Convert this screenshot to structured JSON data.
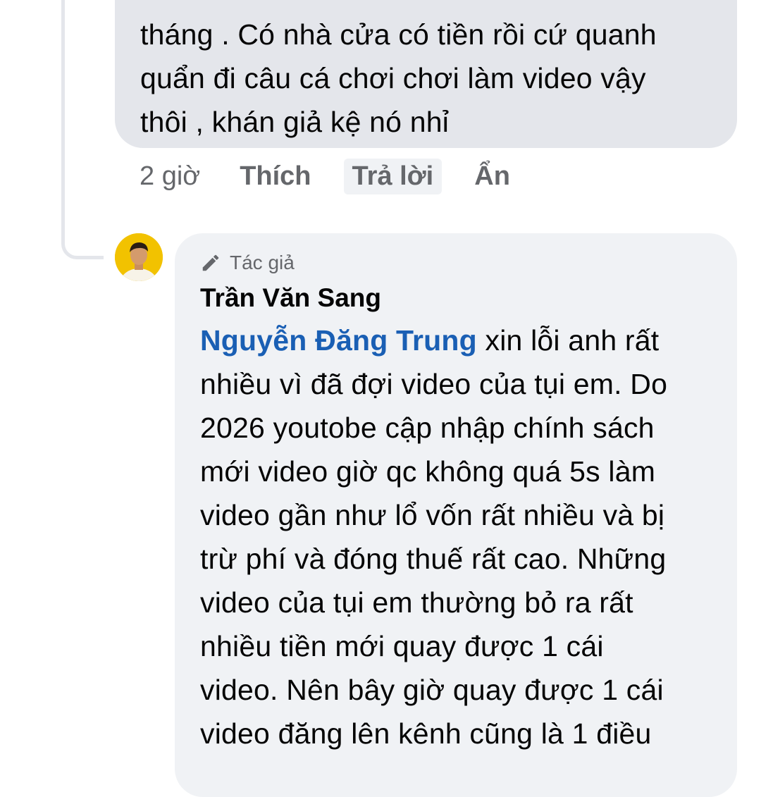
{
  "parent_comment": {
    "text": "tháng . Có nhà cửa có tiền rồi cứ quanh\nquẩn đi câu cá chơi chơi làm video vậy\nthôi , khán giả kệ nó nhỉ",
    "time": "2 giờ",
    "like_label": "Thích",
    "reply_label": "Trả lời",
    "hide_label": "Ẩn"
  },
  "reply": {
    "badge_label": "Tác giả",
    "author": "Trần Văn Sang",
    "mention": "Nguyễn Đăng Trung",
    "text_after_mention": " xin lỗi anh rất\nnhiều vì đã đợi video của tụi em. Do\n2026 youtobe cập nhập chính sách\nmới video giờ qc không quá 5s làm\nvideo gần như lổ vốn rất nhiều và bị\ntrừ phí và đóng thuế rất cao. Những\nvideo của tụi em thường bỏ ra rất\nnhiều tiền mới quay được 1 cái\nvideo.  Nên bây giờ quay được 1 cái\nvideo đăng lên kênh cũng là 1 điều"
  },
  "icons": {
    "badge": "pencil-icon",
    "avatar": "avatar"
  },
  "colors": {
    "parent_bubble": "#e4e6eb",
    "reply_bubble": "#f0f2f5",
    "mention": "#1a5fb4",
    "secondary_text": "#65676b"
  }
}
